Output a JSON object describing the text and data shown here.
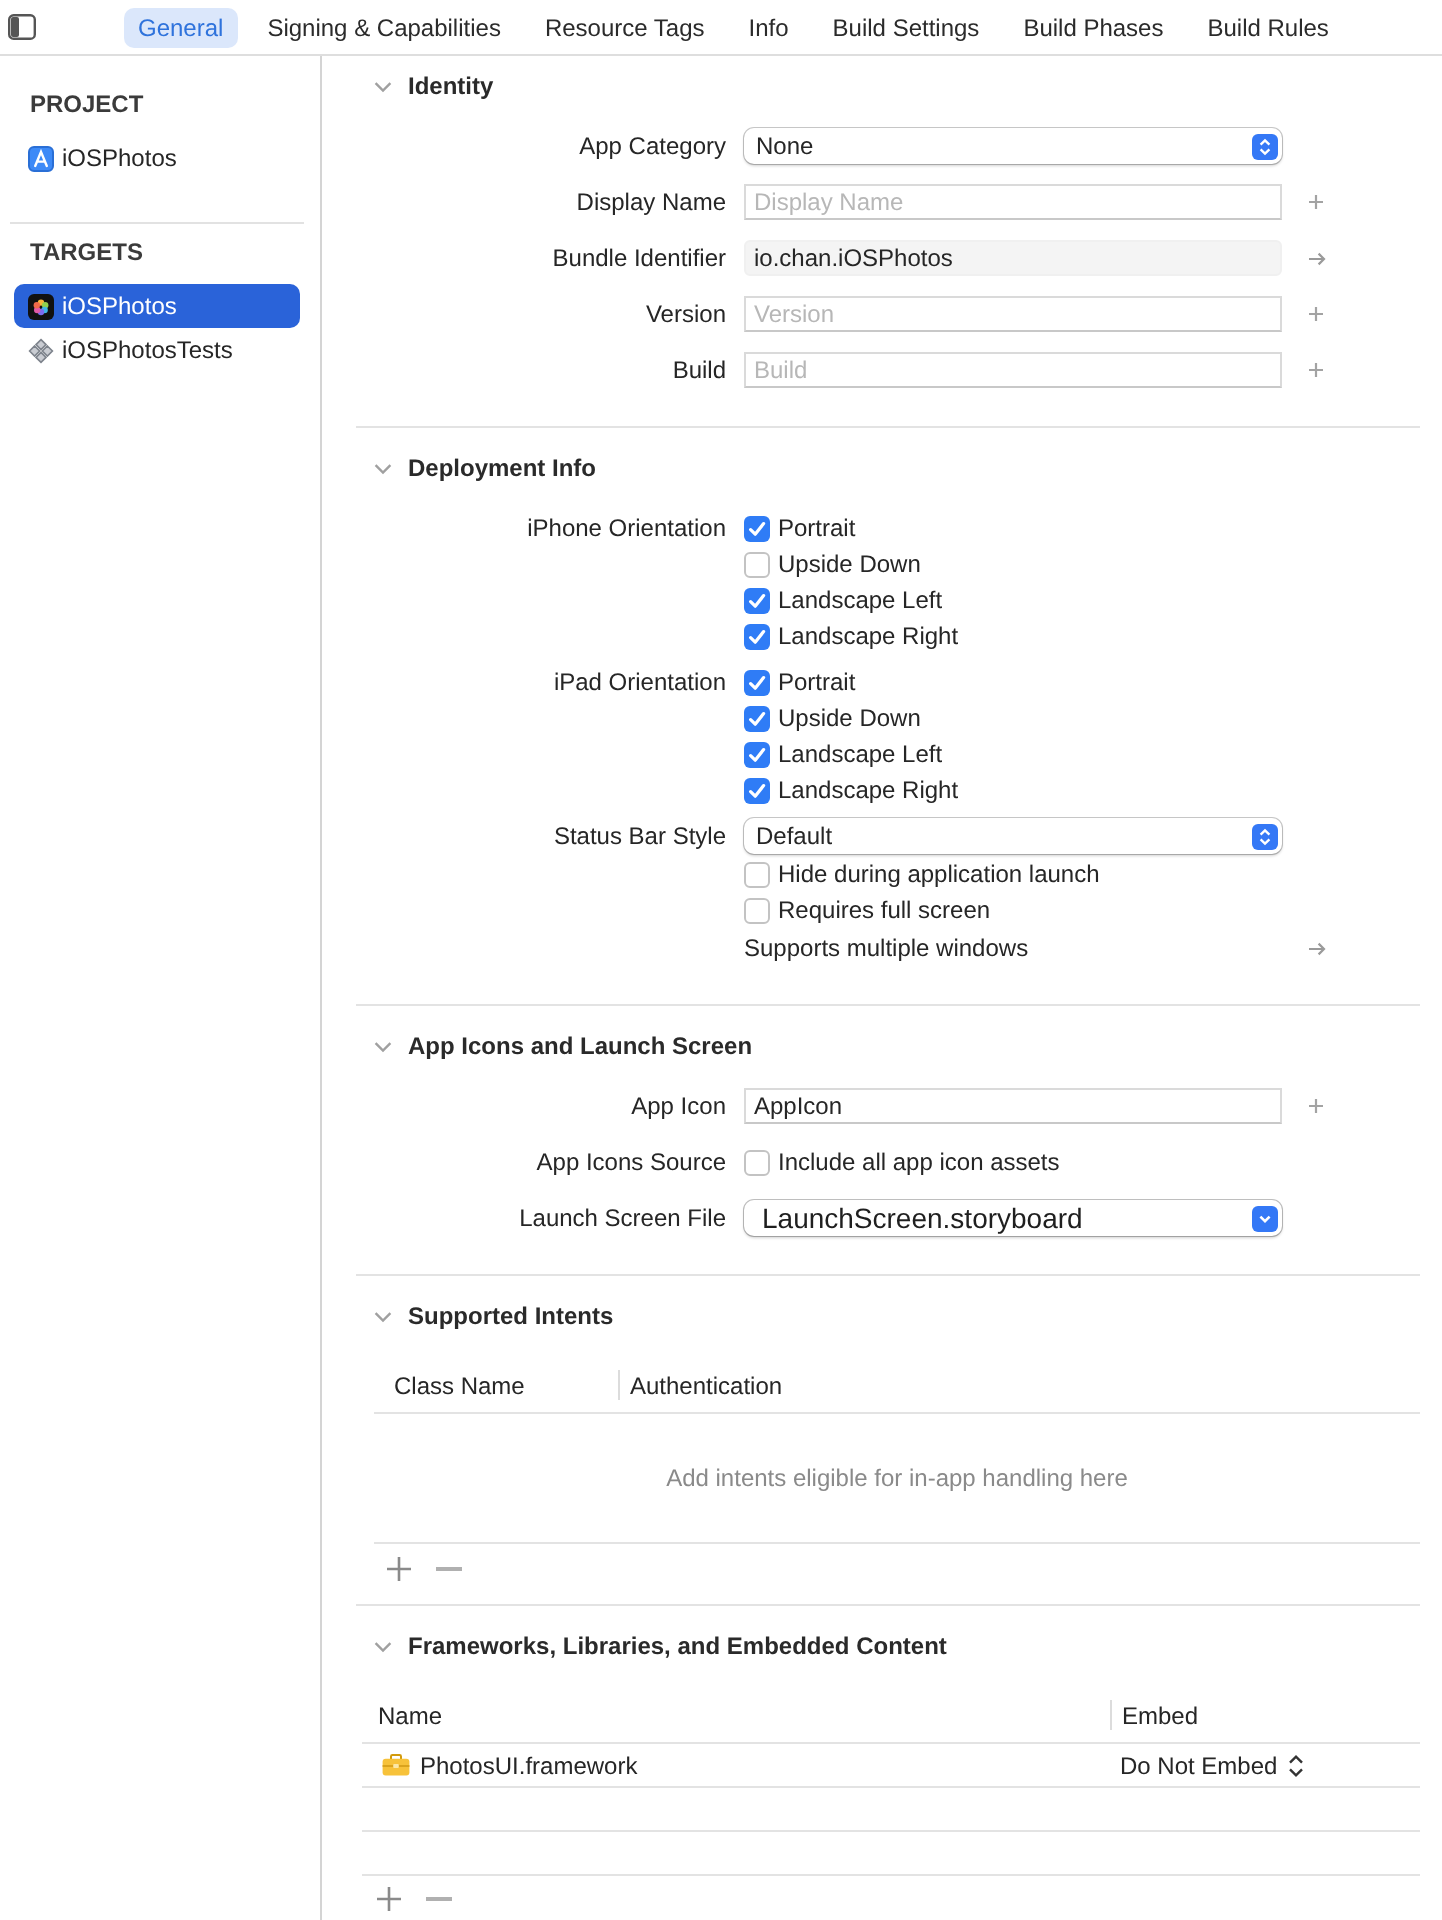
{
  "toolbar": {
    "tabs": [
      {
        "label": "General",
        "selected": true
      },
      {
        "label": "Signing & Capabilities",
        "selected": false
      },
      {
        "label": "Resource Tags",
        "selected": false
      },
      {
        "label": "Info",
        "selected": false
      },
      {
        "label": "Build Settings",
        "selected": false
      },
      {
        "label": "Build Phases",
        "selected": false
      },
      {
        "label": "Build Rules",
        "selected": false
      }
    ]
  },
  "sidebar": {
    "groups": [
      {
        "title": "PROJECT",
        "items": [
          {
            "label": "iOSPhotos",
            "kind": "project",
            "selected": false
          }
        ]
      },
      {
        "title": "TARGETS",
        "items": [
          {
            "label": "iOSPhotos",
            "kind": "app",
            "selected": true
          },
          {
            "label": "iOSPhotosTests",
            "kind": "tests",
            "selected": false
          }
        ]
      }
    ]
  },
  "sections": [
    {
      "title": "Identity",
      "expanded": true,
      "rows": [
        {
          "label": "App Category",
          "kind": "popup",
          "value": "None"
        },
        {
          "label": "Display Name",
          "kind": "text",
          "placeholder": "Display Name",
          "editable": true,
          "accessory": {
            "kind": "add"
          }
        },
        {
          "label": "Bundle Identifier",
          "kind": "text",
          "value": "io.chan.iOSPhotos",
          "editable": false,
          "accessory": {
            "kind": "arrow"
          }
        },
        {
          "label": "Version",
          "kind": "text",
          "placeholder": "Version",
          "editable": true,
          "accessory": {
            "kind": "add"
          }
        },
        {
          "label": "Build",
          "kind": "text",
          "placeholder": "Build",
          "editable": true,
          "accessory": {
            "kind": "add"
          }
        }
      ]
    },
    {
      "title": "Deployment Info",
      "expanded": true,
      "rows": [
        {
          "label": "iPhone Orientation",
          "kind": "checkboxes",
          "options": [
            {
              "label": "Portrait",
              "checked": true
            },
            {
              "label": "Upside Down",
              "checked": false
            },
            {
              "label": "Landscape Left",
              "checked": true
            },
            {
              "label": "Landscape Right",
              "checked": true
            }
          ]
        },
        {
          "label": "iPad Orientation",
          "kind": "checkboxes",
          "options": [
            {
              "label": "Portrait",
              "checked": true
            },
            {
              "label": "Upside Down",
              "checked": true
            },
            {
              "label": "Landscape Left",
              "checked": true
            },
            {
              "label": "Landscape Right",
              "checked": true
            }
          ]
        },
        {
          "label": "Status Bar Style",
          "kind": "popup",
          "value": "Default"
        },
        {
          "kind": "checkboxes",
          "options": [
            {
              "label": "Hide during application launch",
              "checked": false
            },
            {
              "label": "Requires full screen",
              "checked": false
            }
          ]
        },
        {
          "kind": "link",
          "value": "Supports multiple windows",
          "accessory": {
            "kind": "arrow"
          }
        }
      ]
    },
    {
      "title": "App Icons and Launch Screen",
      "expanded": true,
      "rows": [
        {
          "label": "App Icon",
          "kind": "text",
          "value": "AppIcon",
          "editable": true,
          "accessory": {
            "kind": "add"
          }
        },
        {
          "label": "App Icons Source",
          "kind": "checkboxes",
          "options": [
            {
              "label": "Include all app icon assets",
              "checked": false
            }
          ]
        },
        {
          "label": "Launch Screen File",
          "kind": "combo",
          "value": "LaunchScreen.storyboard"
        }
      ]
    },
    {
      "title": "Supported Intents",
      "expanded": true,
      "table": {
        "columns": [
          "Class Name",
          "Authentication"
        ],
        "empty_message": "Add intents eligible for in-app handling here"
      }
    },
    {
      "title": "Frameworks, Libraries, and Embedded Content",
      "expanded": true,
      "table": {
        "columns": [
          "Name",
          "Embed"
        ],
        "rows": [
          {
            "name": "PhotosUI.framework",
            "embed": "Do Not Embed"
          }
        ]
      }
    }
  ]
}
